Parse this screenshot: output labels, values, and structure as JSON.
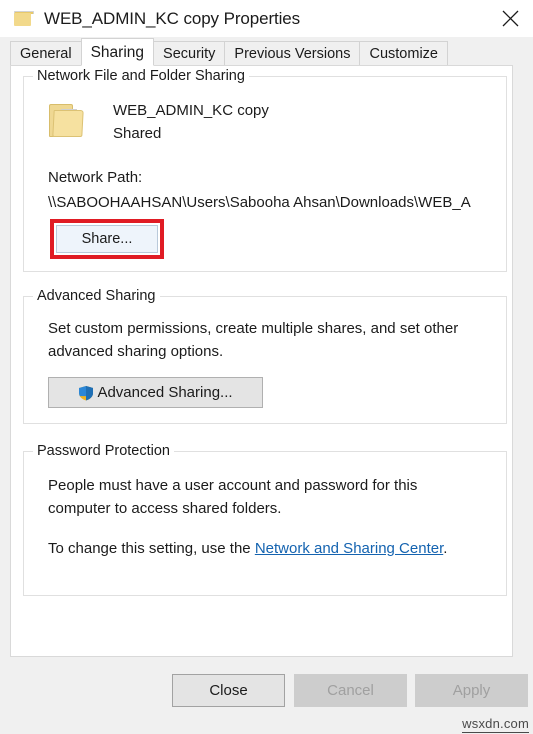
{
  "window": {
    "title": "WEB_ADMIN_KC copy Properties",
    "folder_icon": "folder-icon",
    "close_icon": "close-icon"
  },
  "tabs": [
    {
      "label": "General",
      "active": false
    },
    {
      "label": "Sharing",
      "active": true
    },
    {
      "label": "Security",
      "active": false
    },
    {
      "label": "Previous Versions",
      "active": false
    },
    {
      "label": "Customize",
      "active": false
    }
  ],
  "network_sharing": {
    "group_title": "Network File and Folder Sharing",
    "folder_icon": "folder-icon",
    "share_name": "WEB_ADMIN_KC copy",
    "share_status": "Shared",
    "network_path_label": "Network Path:",
    "network_path_value": "\\\\SABOOHAAHSAN\\Users\\Sabooha Ahsan\\Downloads\\WEB_A",
    "share_button": "Share...",
    "highlight_color": "#e01b24"
  },
  "advanced_sharing": {
    "group_title": "Advanced Sharing",
    "description": "Set custom permissions, create multiple shares, and set other advanced sharing options.",
    "button_label": "Advanced Sharing...",
    "button_icon": "uac-shield-icon"
  },
  "password_protection": {
    "group_title": "Password Protection",
    "description": "People must have a user account and password for this computer to access shared folders.",
    "change_prefix": "To change this setting, use the ",
    "change_link": "Network and Sharing Center",
    "change_suffix": "."
  },
  "footer": {
    "close_label": "Close",
    "cancel_label": "Cancel",
    "apply_label": "Apply"
  },
  "watermark": "wsxdn.com"
}
